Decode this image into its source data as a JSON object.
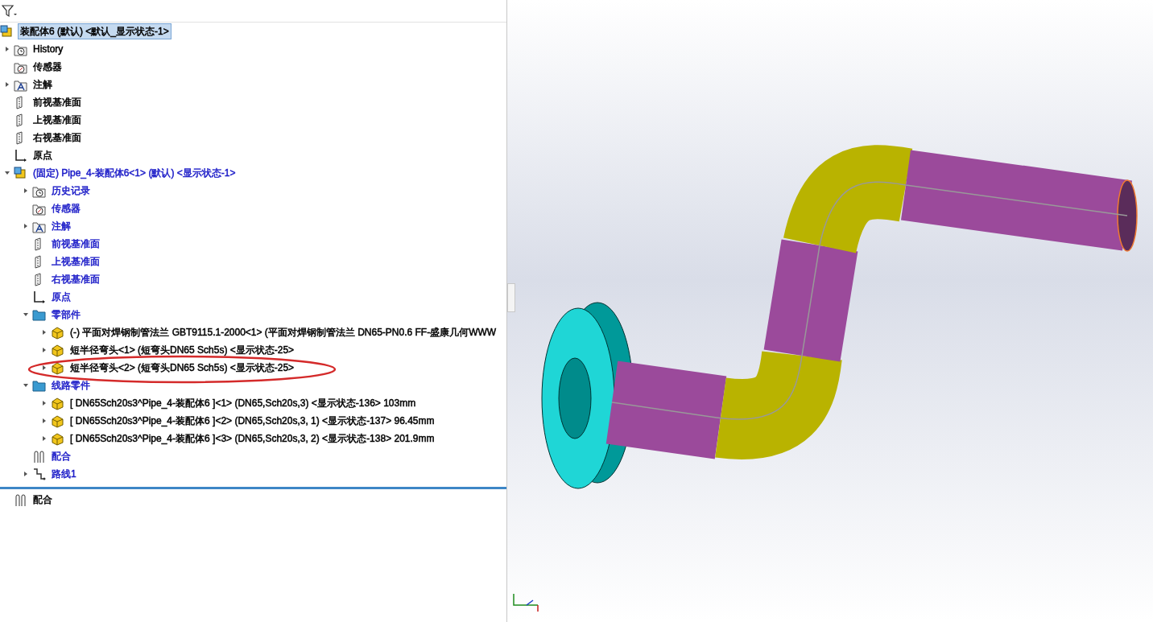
{
  "tree": {
    "items": [
      {
        "label": "装配体6 (默认) <默认_显示状态-1>",
        "kind": "assembly",
        "selected": true,
        "color": "#000000",
        "children": [
          {
            "label": "History",
            "kind": "history",
            "selected": false,
            "color": "#000000",
            "expanded": false
          },
          {
            "label": "传感器",
            "kind": "sensor",
            "selected": false,
            "color": "#000000"
          },
          {
            "label": "注解",
            "kind": "annotation",
            "selected": false,
            "color": "#000000",
            "expanded": false
          },
          {
            "label": "前视基准面",
            "kind": "plane",
            "selected": false,
            "color": "#000000"
          },
          {
            "label": "上视基准面",
            "kind": "plane",
            "selected": false,
            "color": "#000000"
          },
          {
            "label": "右视基准面",
            "kind": "plane",
            "selected": false,
            "color": "#000000"
          },
          {
            "label": "原点",
            "kind": "origin",
            "selected": false,
            "color": "#000000"
          },
          {
            "label": "(固定) Pipe_4-装配体6<1> (默认) <显示状态-1>",
            "kind": "assembly",
            "selected": false,
            "color": "#1c1cc8",
            "expanded": true,
            "children": [
              {
                "label": "历史记录",
                "kind": "history",
                "selected": false,
                "color": "#1c1cc8",
                "expanded": false
              },
              {
                "label": "传感器",
                "kind": "sensor",
                "selected": false,
                "color": "#1c1cc8"
              },
              {
                "label": "注解",
                "kind": "annotation",
                "selected": false,
                "color": "#1c1cc8",
                "expanded": false
              },
              {
                "label": "前视基准面",
                "kind": "plane",
                "selected": false,
                "color": "#1c1cc8"
              },
              {
                "label": "上视基准面",
                "kind": "plane",
                "selected": false,
                "color": "#1c1cc8"
              },
              {
                "label": "右视基准面",
                "kind": "plane",
                "selected": false,
                "color": "#1c1cc8"
              },
              {
                "label": "原点",
                "kind": "origin",
                "selected": false,
                "color": "#1c1cc8"
              },
              {
                "label": "零部件",
                "kind": "folder",
                "selected": false,
                "color": "#1c1cc8",
                "expanded": true,
                "children": [
                  {
                    "label": "(-) 平面对焊钢制管法兰 GBT9115.1-2000<1> (平面对焊钢制管法兰 DN65-PN0.6 FF-盛康几何WWW",
                    "kind": "part",
                    "selected": false,
                    "color": "#000000",
                    "expanded": false
                  },
                  {
                    "label": "短半径弯头<1> (短弯头DN65 Sch5s) <显示状态-25>",
                    "kind": "part",
                    "selected": false,
                    "color": "#000000",
                    "expanded": false
                  },
                  {
                    "label": "短半径弯头<2> (短弯头DN65 Sch5s) <显示状态-25>",
                    "kind": "part",
                    "selected": false,
                    "color": "#000000",
                    "expanded": false
                  }
                ]
              },
              {
                "label": "线路零件",
                "kind": "folder",
                "selected": false,
                "color": "#1c1cc8",
                "expanded": true,
                "children": [
                  {
                    "label": "[ DN65Sch20s3^Pipe_4-装配体6 ]<1> (DN65,Sch20s,3) <显示状态-136> 103mm",
                    "kind": "part",
                    "selected": false,
                    "color": "#000000",
                    "expanded": false
                  },
                  {
                    "label": "[ DN65Sch20s3^Pipe_4-装配体6 ]<2> (DN65,Sch20s,3, 1) <显示状态-137> 96.45mm",
                    "kind": "part",
                    "selected": false,
                    "color": "#000000",
                    "expanded": false
                  },
                  {
                    "label": "[ DN65Sch20s3^Pipe_4-装配体6 ]<3> (DN65,Sch20s,3, 2) <显示状态-138> 201.9mm",
                    "kind": "part",
                    "selected": false,
                    "color": "#000000",
                    "expanded": false
                  }
                ]
              },
              {
                "label": "配合",
                "kind": "mates",
                "selected": false,
                "color": "#1c1cc8"
              },
              {
                "label": "路线1",
                "kind": "route",
                "selected": false,
                "color": "#1c1cc8",
                "expanded": false
              }
            ]
          }
        ]
      }
    ],
    "after_rollback": [
      {
        "label": "配合",
        "kind": "mates",
        "selected": false,
        "color": "#000000"
      }
    ]
  }
}
